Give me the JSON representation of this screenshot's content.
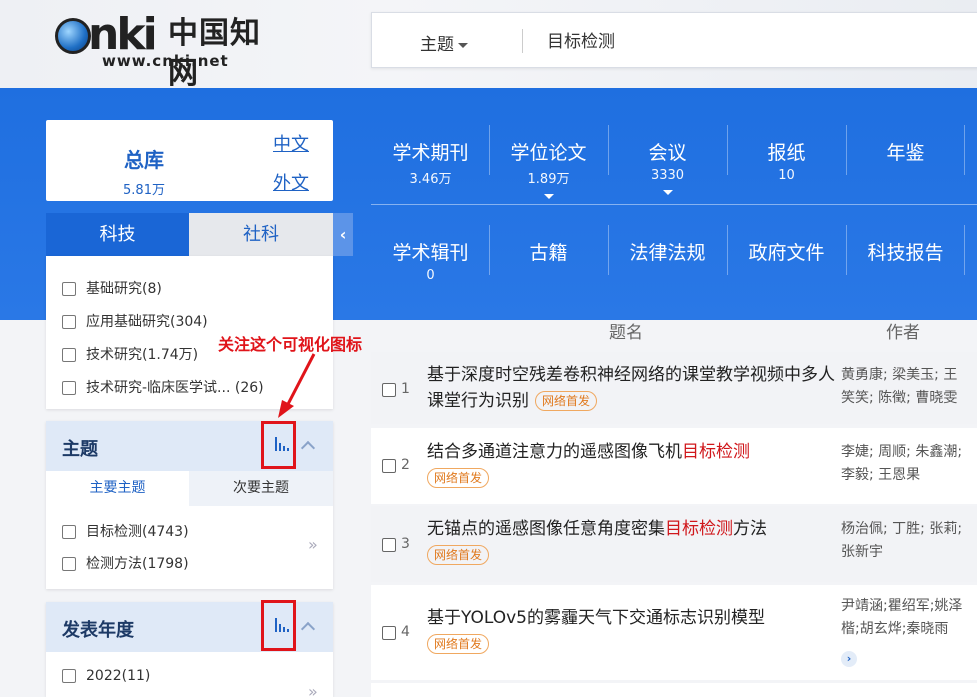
{
  "logo": {
    "url": "www.cnki.net",
    "cn_name": "中国知网"
  },
  "search": {
    "field": "主题",
    "query": "目标检测"
  },
  "zongku": {
    "title": "总库",
    "count": "5.81万",
    "link_cn": "中文",
    "link_en": "外文"
  },
  "databases_row1": [
    {
      "name": "学术期刊",
      "count": "3.46万"
    },
    {
      "name": "学位论文",
      "count": "1.89万"
    },
    {
      "name": "会议",
      "count": "3330"
    },
    {
      "name": "报纸",
      "count": "10"
    },
    {
      "name": "年鉴",
      "count": ""
    }
  ],
  "databases_row2": [
    {
      "name": "学术辑刊",
      "count": "0"
    },
    {
      "name": "古籍",
      "count": ""
    },
    {
      "name": "法律法规",
      "count": ""
    },
    {
      "name": "政府文件",
      "count": ""
    },
    {
      "name": "科技报告",
      "count": ""
    }
  ],
  "category_tabs": {
    "active": "科技",
    "inactive": "社科"
  },
  "category_items": [
    "基础研究(8)",
    "应用基础研究(304)",
    "技术研究(1.74万)",
    "技术研究-临床医学试...  (26)"
  ],
  "topic_facet": {
    "title": "主题",
    "tab_main": "主要主题",
    "tab_secondary": "次要主题",
    "items": [
      "目标检测(4743)",
      "检测方法(1798)"
    ]
  },
  "year_facet": {
    "title": "发表年度",
    "items": [
      "2022(11)"
    ]
  },
  "annotation": "关注这个可视化图标",
  "results_header": {
    "title": "题名",
    "author": "作者"
  },
  "results": [
    {
      "no": "1",
      "title_pre": "基于深度时空残差卷积神经网络的课堂教学视频中多人课堂行为识别",
      "highlight": "",
      "title_post": "",
      "badge": "网络首发",
      "authors_l1": "黄勇康; 梁美玉; 王",
      "authors_l2": "笑笑; 陈徵; 曹晓雯"
    },
    {
      "no": "2",
      "title_pre": "结合多通道注意力的遥感图像飞机",
      "highlight": "目标检测",
      "title_post": "",
      "badge": "网络首发",
      "authors_l1": "李婕; 周顺; 朱鑫潮;",
      "authors_l2": "李毅; 王恩果"
    },
    {
      "no": "3",
      "title_pre": "无锚点的遥感图像任意角度密集",
      "highlight": "目标检测",
      "title_post": "方法",
      "badge": "网络首发",
      "authors_l1": "杨治佩; 丁胜; 张莉;",
      "authors_l2": "张新宇"
    },
    {
      "no": "4",
      "title_pre": "基于YOLOv5的雾霾天气下交通标志识别模型",
      "highlight": "",
      "title_post": "",
      "badge": "网络首发",
      "authors_l1": "尹靖涵;瞿绍军;姚泽",
      "authors_l2": "楷;胡玄烨;秦晓雨"
    }
  ],
  "more_symbol": "»",
  "collapse_symbol": "‹",
  "expand_symbol": "›",
  "colors": {
    "band": "#2a78e6",
    "primary": "#1f62c4",
    "highlight": "#d0171b",
    "annotation": "#e0141a",
    "badge": "#e07a1f"
  }
}
